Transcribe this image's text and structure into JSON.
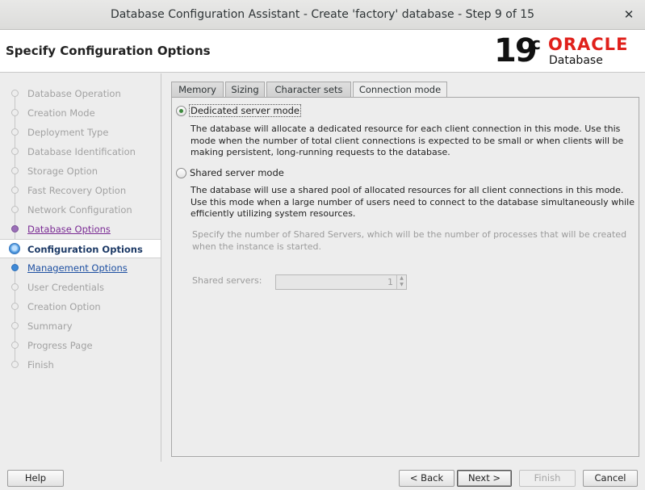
{
  "window": {
    "title": "Database Configuration Assistant - Create 'factory' database - Step 9 of 15",
    "close_glyph": "✕"
  },
  "header": {
    "page_title": "Specify Configuration Options",
    "logo_version": "19",
    "logo_version_sup": "c",
    "logo_brand": "ORACLE",
    "logo_product": "Database"
  },
  "sidebar": {
    "steps": [
      {
        "label": "Database Operation",
        "state": "done"
      },
      {
        "label": "Creation Mode",
        "state": "done"
      },
      {
        "label": "Deployment Type",
        "state": "done"
      },
      {
        "label": "Database Identification",
        "state": "done"
      },
      {
        "label": "Storage Option",
        "state": "done"
      },
      {
        "label": "Fast Recovery Option",
        "state": "done"
      },
      {
        "label": "Network Configuration",
        "state": "done"
      },
      {
        "label": "Database Options",
        "state": "visited"
      },
      {
        "label": "Configuration Options",
        "state": "current"
      },
      {
        "label": "Management Options",
        "state": "link"
      },
      {
        "label": "User Credentials",
        "state": "pending"
      },
      {
        "label": "Creation Option",
        "state": "pending"
      },
      {
        "label": "Summary",
        "state": "pending"
      },
      {
        "label": "Progress Page",
        "state": "pending"
      },
      {
        "label": "Finish",
        "state": "pending"
      }
    ]
  },
  "tabs": {
    "memory": "Memory",
    "sizing": "Sizing",
    "character_sets": "Character sets",
    "connection_mode": "Connection mode",
    "active": "connection_mode"
  },
  "connection_mode": {
    "dedicated_label": "Dedicated server mode",
    "dedicated_selected": true,
    "dedicated_desc": "The database will allocate a dedicated resource for each client connection in this mode. Use this mode when the number of total client connections is expected to be small or when clients will be making persistent, long-running requests to the database.",
    "shared_label": "Shared server mode",
    "shared_desc": "The database will use a shared pool of allocated resources for all client connections in this mode.  Use this mode when a large number of users need to connect to the database simultaneously while efficiently utilizing system resources.",
    "shared_servers_desc": "Specify the number of Shared Servers, which will be the number of processes that will be created when the instance is started.",
    "shared_servers_label": "Shared servers:",
    "shared_servers_value": "1"
  },
  "buttons": {
    "help": "Help",
    "back": "< Back",
    "next": "Next >",
    "finish": "Finish",
    "cancel": "Cancel"
  }
}
